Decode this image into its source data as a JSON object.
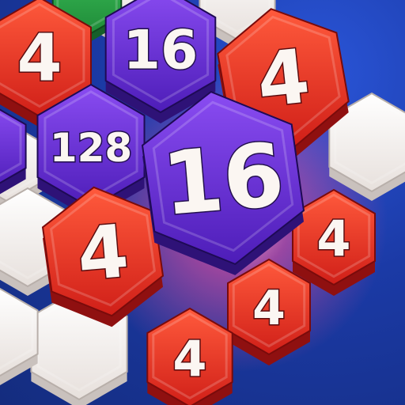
{
  "game": {
    "background_color": "#1b3aa6",
    "colors": {
      "red_top": "#ef3b2c",
      "red_mid": "#d8231b",
      "red_side": "#8f1010",
      "purple_top": "#7b3fe8",
      "purple_mid": "#5a23c9",
      "purple_side": "#2e1277",
      "white_top": "#f5f1ee",
      "white_side": "#c9c1bd",
      "green_top": "#2fa84a",
      "glow": "#ff4f9a"
    }
  },
  "tiles": [
    {
      "name": "empty-slot-top-left",
      "color": "white",
      "label": ""
    },
    {
      "name": "empty-slot-top-green",
      "color": "green",
      "label": ""
    },
    {
      "name": "empty-slot-top-right",
      "color": "white",
      "label": ""
    },
    {
      "name": "empty-slot-right-mid",
      "color": "white",
      "label": ""
    },
    {
      "name": "empty-slot-left-mid",
      "color": "white",
      "label": ""
    },
    {
      "name": "empty-slot-left-low",
      "color": "white",
      "label": ""
    },
    {
      "name": "empty-slot-bottom-left",
      "color": "white",
      "label": ""
    },
    {
      "name": "empty-slot-bottom-left-2",
      "color": "white",
      "label": ""
    },
    {
      "name": "tile-4-top-left",
      "color": "red",
      "label": "4"
    },
    {
      "name": "tile-16-top",
      "color": "purple",
      "label": "16"
    },
    {
      "name": "tile-purple-left-edge",
      "color": "purple",
      "label": ""
    },
    {
      "name": "tile-128",
      "color": "purple",
      "label": "128"
    },
    {
      "name": "tile-4-top-right",
      "color": "red",
      "label": "4"
    },
    {
      "name": "tile-4-right",
      "color": "red",
      "label": "4"
    },
    {
      "name": "tile-4-bottom-right",
      "color": "red",
      "label": "4"
    },
    {
      "name": "tile-4-bottom",
      "color": "red",
      "label": "4"
    },
    {
      "name": "tile-4-left",
      "color": "red",
      "label": "4"
    },
    {
      "name": "tile-16-center",
      "color": "purple",
      "label": "16"
    }
  ]
}
